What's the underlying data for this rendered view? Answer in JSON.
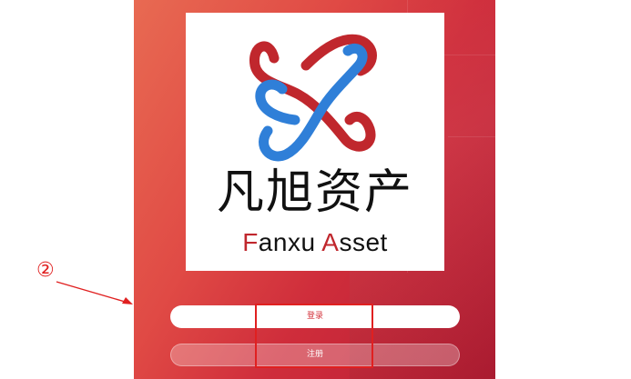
{
  "brand": {
    "name_cn": "凡旭资产",
    "name_en_F": "F",
    "name_en_mid": "anxu ",
    "name_en_A": "A",
    "name_en_rest": "sset"
  },
  "buttons": {
    "login_label": "登录",
    "register_label": "注册"
  },
  "annotation": {
    "marker": "②"
  },
  "colors": {
    "accent_red": "#c0272d",
    "logo_blue": "#2f7fd8",
    "annotation_red": "#e02020"
  }
}
